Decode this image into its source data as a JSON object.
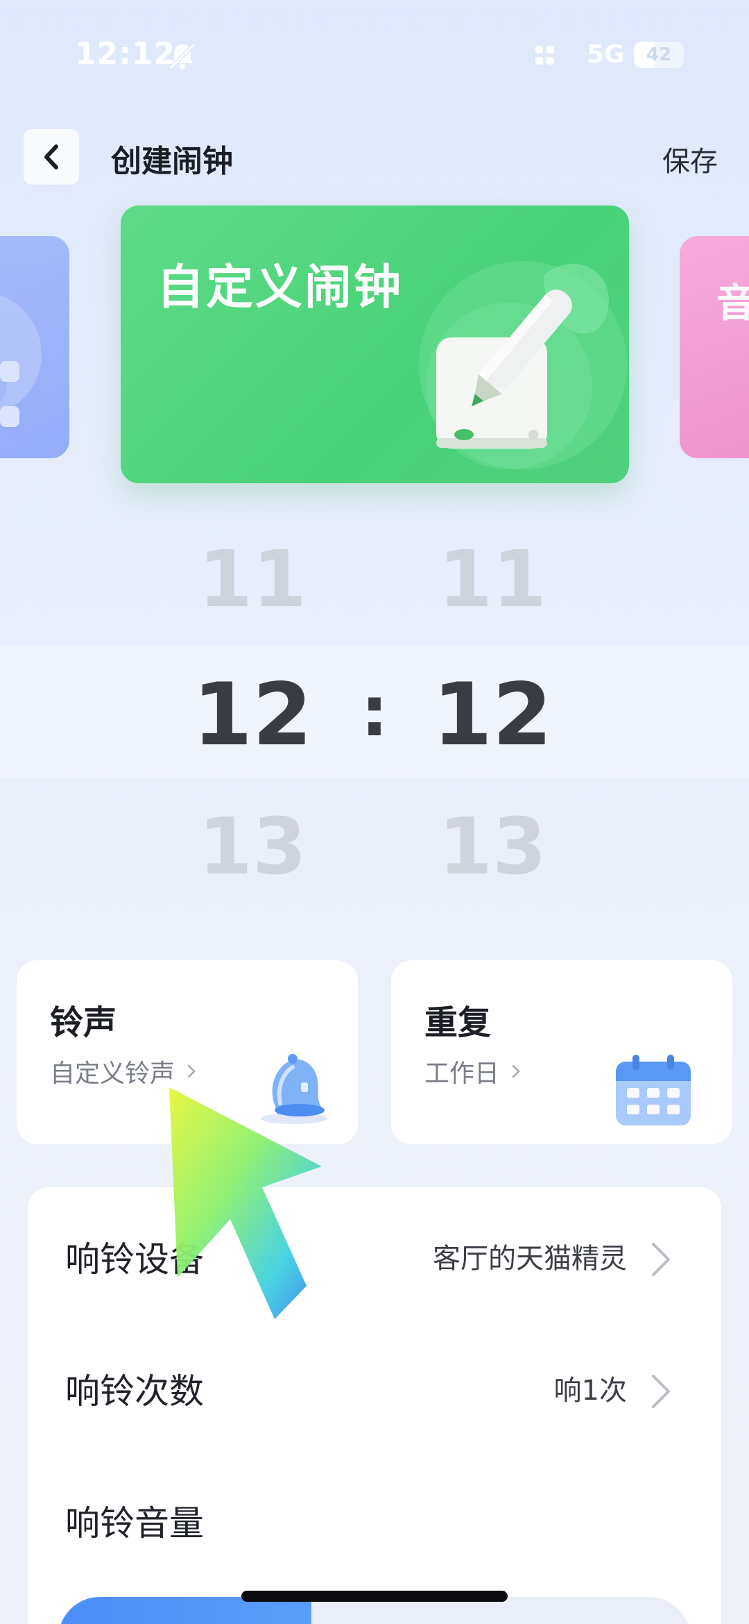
{
  "status_bar": {
    "time": "12:12",
    "network": "5G",
    "battery": "42",
    "battery_level": 0.42
  },
  "nav": {
    "title": "创建闹钟",
    "save_label": "保存"
  },
  "carousel": {
    "active_card": "自定义闹钟",
    "right_card_partial": "音"
  },
  "time_picker": {
    "hours": [
      "11",
      "12",
      "13"
    ],
    "minutes": [
      "11",
      "12",
      "13"
    ],
    "selected_hour": "12",
    "selected_minute": "12",
    "separator": ":"
  },
  "tiles": {
    "ringtone": {
      "title": "铃声",
      "value": "自定义铃声"
    },
    "repeat": {
      "title": "重复",
      "value": "工作日"
    }
  },
  "settings": [
    {
      "label": "响铃设备",
      "value": "客厅的天猫精灵"
    },
    {
      "label": "响铃次数",
      "value": "响1次"
    },
    {
      "label": "响铃音量",
      "value": ""
    }
  ],
  "colors": {
    "card_green": "#4fd07c",
    "accent_blue": "#4a8ef8",
    "card_pink": "#ee94cc",
    "card_blue": "#8aa6f7"
  }
}
